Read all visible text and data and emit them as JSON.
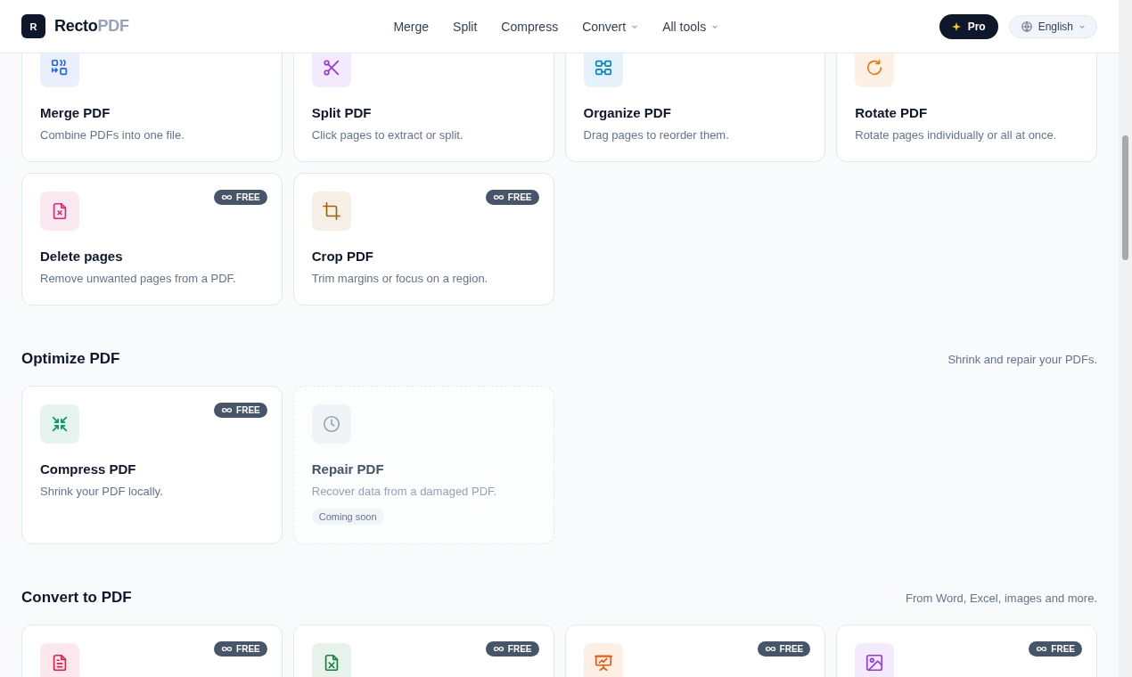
{
  "header": {
    "logo_letter": "R",
    "brand": "Recto",
    "brand_suffix": "PDF",
    "nav": [
      {
        "label": "Merge",
        "dropdown": false
      },
      {
        "label": "Split",
        "dropdown": false
      },
      {
        "label": "Compress",
        "dropdown": false
      },
      {
        "label": "Convert",
        "dropdown": true
      },
      {
        "label": "All tools",
        "dropdown": true
      }
    ],
    "pro_button": "Pro",
    "language": "English"
  },
  "sections": [
    {
      "cards": [
        {
          "kind": "merge",
          "color": "#2563eb",
          "title": "Merge PDF",
          "description": "Combine PDFs into one file.",
          "disabled": false
        },
        {
          "kind": "split",
          "color": "#9333ea",
          "title": "Split PDF",
          "description": "Click pages to extract or split.",
          "disabled": false
        },
        {
          "kind": "organize",
          "color": "#0284c7",
          "title": "Organize PDF",
          "description": "Drag pages to reorder them.",
          "disabled": false
        },
        {
          "kind": "rotate",
          "color": "#ea7a0c",
          "title": "Rotate PDF",
          "description": "Rotate pages individually or all at once.",
          "disabled": false
        },
        {
          "kind": "delete",
          "color": "#db2777",
          "badge": "FREE",
          "title": "Delete pages",
          "description": "Remove unwanted pages from a PDF.",
          "disabled": false
        },
        {
          "kind": "crop",
          "color": "#a16207",
          "badge": "FREE",
          "title": "Crop PDF",
          "description": "Trim margins or focus on a region.",
          "disabled": false
        }
      ]
    },
    {
      "title": "Optimize PDF",
      "subtitle": "Shrink and repair your PDFs.",
      "cards": [
        {
          "kind": "compress",
          "color": "#059669",
          "badge": "FREE",
          "title": "Compress PDF",
          "description": "Shrink your PDF locally.",
          "disabled": false
        },
        {
          "kind": "repair",
          "color": "#94a3b8",
          "title": "Repair PDF",
          "description": "Recover data from a damaged PDF.",
          "status": "Coming soon",
          "disabled": true
        }
      ]
    },
    {
      "title": "Convert to PDF",
      "subtitle": "From Word, Excel, images and more.",
      "cards": [
        {
          "kind": "word",
          "color": "#e11d48",
          "badge": "FREE",
          "disabled": false
        },
        {
          "kind": "excel",
          "color": "#15803d",
          "badge": "FREE",
          "disabled": false
        },
        {
          "kind": "powerpoint",
          "color": "#ea580c",
          "badge": "FREE",
          "disabled": false
        },
        {
          "kind": "image",
          "color": "#9333ea",
          "badge": "FREE",
          "disabled": false
        }
      ]
    }
  ]
}
